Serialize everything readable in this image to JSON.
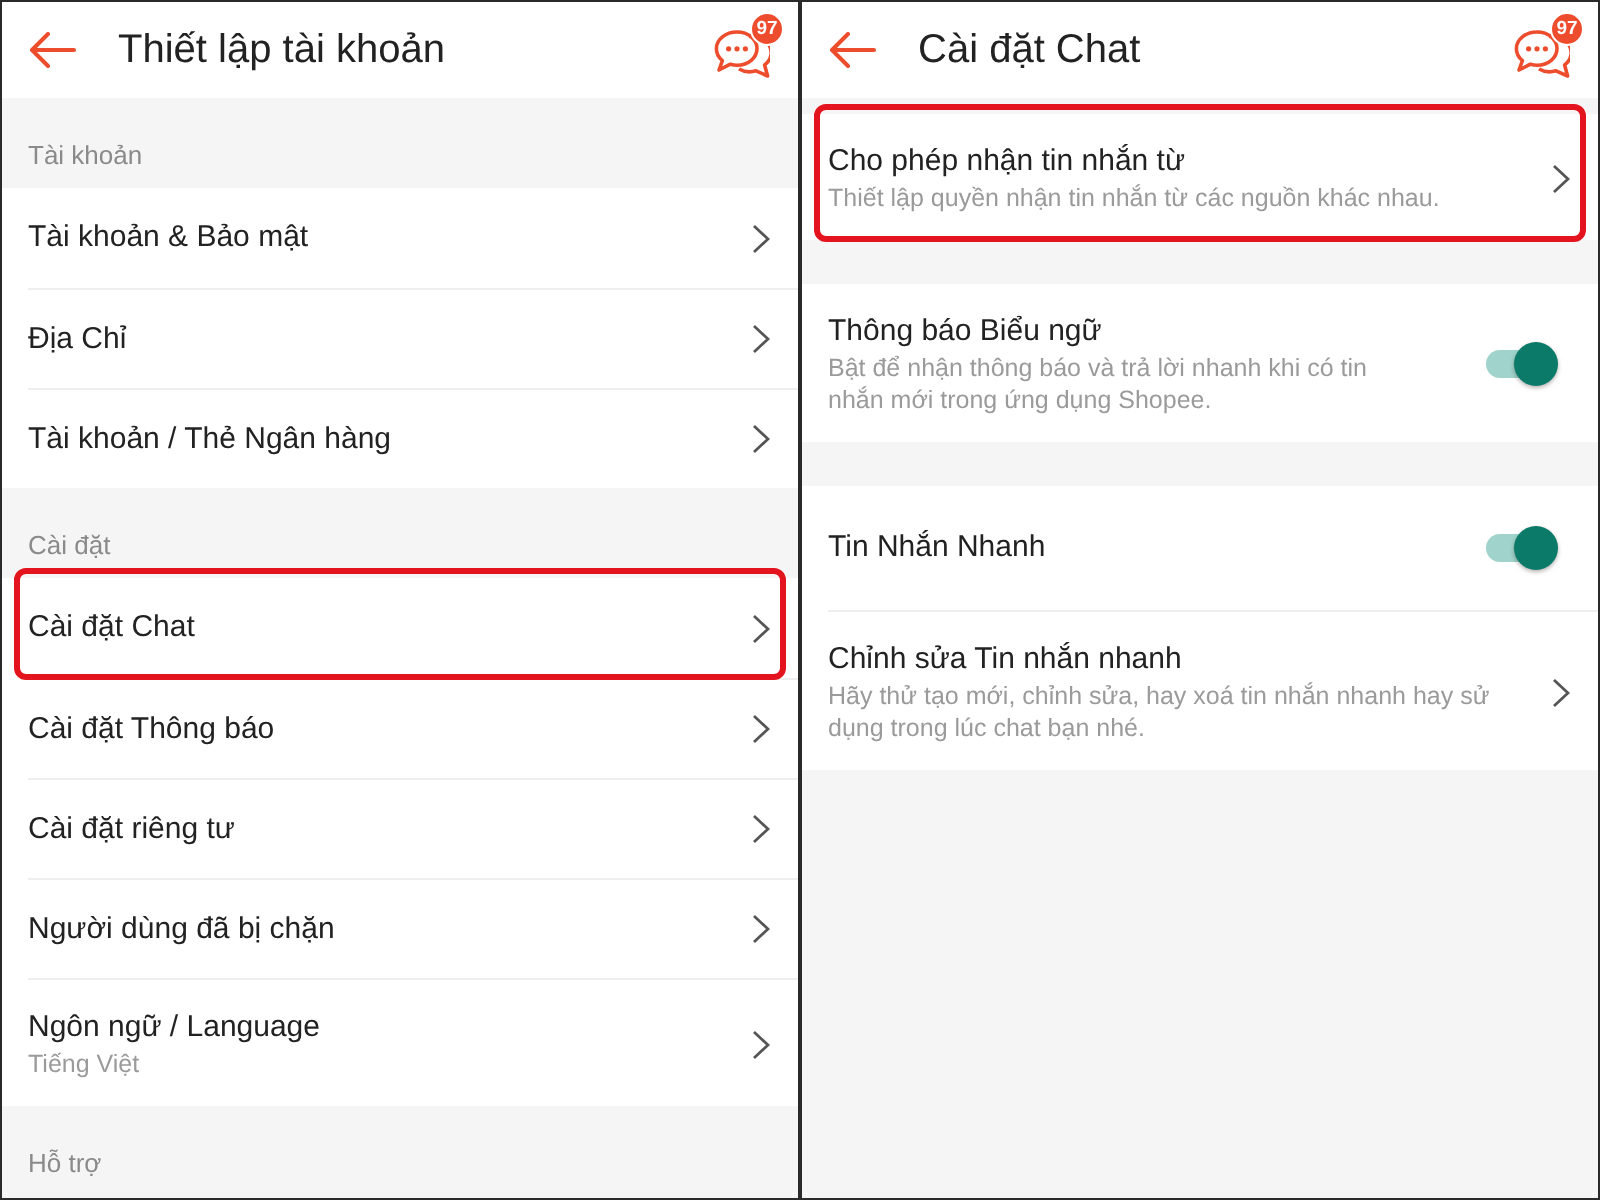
{
  "panels": [
    {
      "header": {
        "title": "Thiết lập tài khoản",
        "badge": "97"
      },
      "sections": [
        {
          "label": "Tài khoản",
          "items": [
            {
              "kind": "link",
              "title": "Tài khoản & Bảo mật",
              "highlighted": false
            },
            {
              "kind": "link",
              "title": "Địa Chỉ",
              "highlighted": false
            },
            {
              "kind": "link",
              "title": "Tài khoản / Thẻ Ngân hàng",
              "highlighted": false
            }
          ]
        },
        {
          "label": "Cài đặt",
          "items": [
            {
              "kind": "link",
              "title": "Cài đặt Chat",
              "highlighted": true
            },
            {
              "kind": "link",
              "title": "Cài đặt Thông báo",
              "highlighted": false
            },
            {
              "kind": "link",
              "title": "Cài đặt riêng tư",
              "highlighted": false
            },
            {
              "kind": "link",
              "title": "Người dùng đã bị chặn",
              "highlighted": false
            },
            {
              "kind": "link",
              "title": "Ngôn ngữ / Language",
              "subtitle": "Tiếng Việt",
              "highlighted": false
            }
          ]
        },
        {
          "label": "Hỗ trợ"
        }
      ]
    },
    {
      "header": {
        "title": "Cài đặt Chat",
        "badge": "97"
      },
      "sections": [
        {
          "items": [
            {
              "kind": "link",
              "title": "Cho phép nhận tin nhắn từ",
              "subtitle": "Thiết lập quyền nhận tin nhắn từ các nguồn khác nhau.",
              "highlighted": true
            }
          ]
        },
        {
          "items": [
            {
              "kind": "toggle",
              "title": "Thông báo Biểu ngữ",
              "subtitle": "Bật để nhận thông báo và trả lời nhanh khi có tin nhắn mới trong ứng dụng Shopee.",
              "on": true,
              "highlighted": false
            }
          ]
        },
        {
          "items": [
            {
              "kind": "toggle",
              "title": "Tin Nhắn Nhanh",
              "on": true,
              "highlighted": false
            },
            {
              "kind": "link",
              "title": "Chỉnh sửa Tin nhắn nhanh",
              "subtitle": "Hãy thử tạo mới, chỉnh sửa, hay xoá tin nhắn nhanh hay sử dụng trong lúc chat bạn nhé.",
              "highlighted": false
            }
          ]
        }
      ]
    }
  ]
}
